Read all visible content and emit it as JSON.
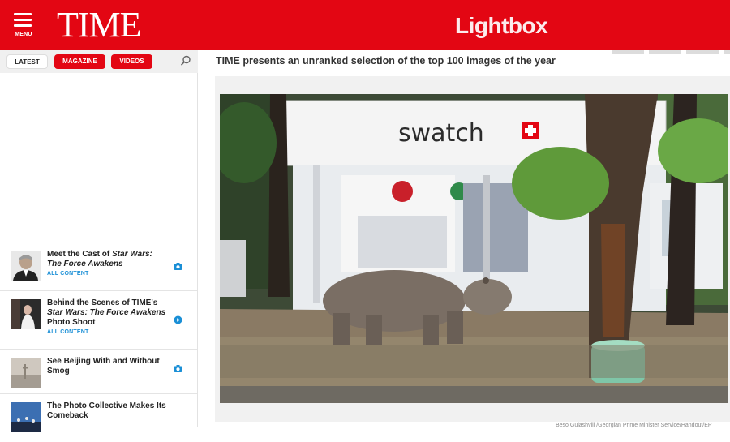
{
  "header": {
    "menu_label": "MENU",
    "logo": "TIME",
    "section": "Lightbox",
    "colors": {
      "brand": "#e30613",
      "link": "#1a8fd6"
    }
  },
  "sidebar": {
    "tabs": [
      "LATEST",
      "MAGAZINE",
      "VIDEOS"
    ],
    "search_icon": "search-icon",
    "items": [
      {
        "title_plain": "Meet the Cast of ",
        "title_italic": "Star Wars: The Force Awakens",
        "tag": "ALL CONTENT",
        "media": "camera-icon"
      },
      {
        "title_plain": "Behind the Scenes of TIME's ",
        "title_italic": "Star Wars: The Force Awakens",
        "title_suffix": " Photo Shoot",
        "tag": "ALL CONTENT",
        "media": "play-icon"
      },
      {
        "title_plain": "See Beijing With and Without Smog",
        "media": "camera-icon"
      },
      {
        "title_plain": "The Photo Collective Makes Its Comeback"
      }
    ]
  },
  "main": {
    "intro": "TIME presents an unranked selection of the top 100 images of the year",
    "store_sign": "swatch",
    "credit": "Beso Gulashvili /Georgian Prime Minister Service/Handout/EP"
  }
}
